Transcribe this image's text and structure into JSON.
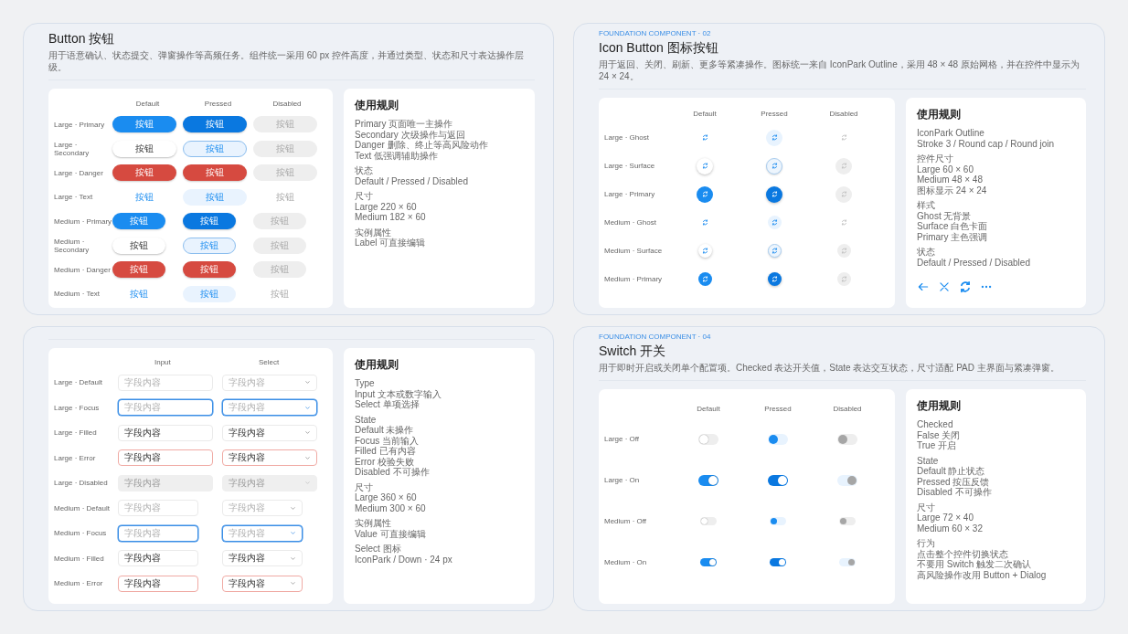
{
  "panels": [
    {
      "kind": "buttons",
      "title": "Button 按钮",
      "description": "用于语意确认、状态提交、弹窗操作等高频任务。组件统一采用 60 px 控件高度，并通过类型、状态和尺寸表达操作层级。",
      "columns": [
        {
          "label": "Default",
          "kind": "default"
        },
        {
          "label": "Pressed",
          "kind": "pressed"
        },
        {
          "label": "Disabled",
          "kind": "disabled"
        }
      ],
      "rows": [
        {
          "label": "Large · Primary",
          "large": true,
          "kind": "primary",
          "cells": [
            "按钮",
            "按钮",
            "按钮"
          ]
        },
        {
          "label": "Large · Secondary",
          "large": true,
          "kind": "secondary",
          "cells": [
            "按钮",
            "按钮",
            "按钮"
          ]
        },
        {
          "label": "Large · Danger",
          "large": true,
          "kind": "danger",
          "cells": [
            "按钮",
            "按钮",
            "按钮"
          ]
        },
        {
          "label": "Large · Text",
          "large": true,
          "kind": "text",
          "cells": [
            "按钮",
            "按钮",
            "按钮"
          ]
        },
        {
          "label": "Medium · Primary",
          "large": false,
          "kind": "primary",
          "cells": [
            "按钮",
            "按钮",
            "按钮"
          ]
        },
        {
          "label": "Medium · Secondary",
          "large": false,
          "kind": "secondary",
          "cells": [
            "按钮",
            "按钮",
            "按钮"
          ]
        },
        {
          "label": "Medium · Danger",
          "large": false,
          "kind": "danger",
          "cells": [
            "按钮",
            "按钮",
            "按钮"
          ]
        },
        {
          "label": "Medium · Text",
          "large": false,
          "kind": "text",
          "cells": [
            "按钮",
            "按钮",
            "按钮"
          ]
        }
      ],
      "rules": {
        "title": "使用规则",
        "groups": [
          [
            "Primary 页面唯一主操作",
            "Secondary 次级操作与返回",
            "Danger 删除、终止等高风险动作",
            "Text 低强调辅助操作"
          ],
          [
            "状态",
            "Default / Pressed / Disabled"
          ],
          [
            "尺寸",
            "Large 220 × 60",
            "Medium 182 × 60"
          ],
          [
            "实例属性",
            "Label 可直接编辑"
          ]
        ]
      }
    },
    {
      "kind": "icon_buttons",
      "eyebrow": "FOUNDATION COMPONENT · 02",
      "title": "Icon Button 图标按钮",
      "description": "用于返回、关闭、刷新、更多等紧凑操作。图标统一来自 IconPark Outline，采用 48 × 48 原始网格，并在控件中显示为 24 × 24。",
      "columns": [
        {
          "label": "Default",
          "kind": "default"
        },
        {
          "label": "Pressed",
          "kind": "pressed"
        },
        {
          "label": "Disabled",
          "kind": "disabled"
        }
      ],
      "rows": [
        {
          "label": "Large · Ghost",
          "large": true,
          "kind": "ghost"
        },
        {
          "label": "Large · Surface",
          "large": true,
          "kind": "surface"
        },
        {
          "label": "Large · Primary",
          "large": true,
          "kind": "primary"
        },
        {
          "label": "Medium · Ghost",
          "large": false,
          "kind": "ghost"
        },
        {
          "label": "Medium · Surface",
          "large": false,
          "kind": "surface"
        },
        {
          "label": "Medium · Primary",
          "large": false,
          "kind": "primary"
        }
      ],
      "rules": {
        "title": "使用规则",
        "groups": [
          [
            "IconPark Outline",
            "Stroke 3 / Round cap / Round join"
          ],
          [
            "控件尺寸",
            "Large 60 × 60",
            "Medium 48 × 48",
            "图标显示 24 × 24"
          ],
          [
            "样式",
            "Ghost 无背景",
            "Surface 白色卡面",
            "Primary 主色强调"
          ],
          [
            "状态",
            "Default / Pressed / Disabled"
          ]
        ]
      }
    },
    {
      "kind": "fields",
      "columns": [
        {
          "label": "Input",
          "kind": "input"
        },
        {
          "label": "Select",
          "kind": "select"
        }
      ],
      "rows": [
        {
          "label": "Large · Default",
          "large": true,
          "kind": "default",
          "cells": [
            {
              "placeholder": "字段内容"
            },
            {
              "placeholder": "字段内容"
            }
          ]
        },
        {
          "label": "Large · Focus",
          "large": true,
          "kind": "focus",
          "cells": [
            {
              "placeholder": "字段内容"
            },
            {
              "placeholder": "字段内容"
            }
          ]
        },
        {
          "label": "Large · Filled",
          "large": true,
          "kind": "filled",
          "cells": [
            {
              "value": "字段内容"
            },
            {
              "value": "字段内容"
            }
          ]
        },
        {
          "label": "Large · Error",
          "large": true,
          "kind": "error",
          "cells": [
            {
              "value": "字段内容"
            },
            {
              "value": "字段内容"
            }
          ]
        },
        {
          "label": "Large · Disabled",
          "large": true,
          "kind": "disabled",
          "cells": [
            {
              "placeholder": "字段内容"
            },
            {
              "placeholder": "字段内容"
            }
          ]
        },
        {
          "label": "Medium · Default",
          "large": false,
          "kind": "default",
          "cells": [
            {
              "placeholder": "字段内容"
            },
            {
              "placeholder": "字段内容"
            }
          ]
        },
        {
          "label": "Medium · Focus",
          "large": false,
          "kind": "focus",
          "cells": [
            {
              "placeholder": "字段内容"
            },
            {
              "placeholder": "字段内容"
            }
          ]
        },
        {
          "label": "Medium · Filled",
          "large": false,
          "kind": "filled",
          "cells": [
            {
              "value": "字段内容"
            },
            {
              "value": "字段内容"
            }
          ]
        },
        {
          "label": "Medium · Error",
          "large": false,
          "kind": "error",
          "cells": [
            {
              "value": "字段内容"
            },
            {
              "value": "字段内容"
            }
          ]
        }
      ],
      "rules": {
        "title": "使用规则",
        "groups": [
          [
            "Type",
            "Input 文本或数字输入",
            "Select 单项选择"
          ],
          [
            "State",
            "Default 未操作",
            "Focus 当前输入",
            "Filled 已有内容",
            "Error 校验失败",
            "Disabled 不可操作"
          ],
          [
            "尺寸",
            "Large 360 × 60",
            "Medium 300 × 60"
          ],
          [
            "实例属性",
            "Value 可直接编辑"
          ],
          [
            "Select 图标",
            "IconPark / Down · 24 px"
          ]
        ]
      }
    },
    {
      "kind": "switches",
      "eyebrow": "FOUNDATION COMPONENT · 04",
      "title": "Switch 开关",
      "description": "用于即时开启或关闭单个配置项。Checked 表达开关值，State 表达交互状态，尺寸适配 PAD 主界面与紧凑弹窗。",
      "columns": [
        {
          "label": "Default",
          "kind": "default"
        },
        {
          "label": "Pressed",
          "kind": "pressed"
        },
        {
          "label": "Disabled",
          "kind": "disabled"
        }
      ],
      "rows": [
        {
          "label": "Large · Off",
          "large": true,
          "on": false
        },
        {
          "label": "Large · On",
          "large": true,
          "on": true
        },
        {
          "label": "Medium · Off",
          "large": false,
          "on": false
        },
        {
          "label": "Medium · On",
          "large": false,
          "on": true
        }
      ],
      "rules": {
        "title": "使用规则",
        "groups": [
          [
            "Checked",
            "False 关闭",
            "True 开启"
          ],
          [
            "State",
            "Default 静止状态",
            "Pressed 按压反馈",
            "Disabled 不可操作"
          ],
          [
            "尺寸",
            "Large 72 × 40",
            "Medium 60 × 32"
          ],
          [
            "行为",
            "点击整个控件切换状态",
            "不要用 Switch 触发二次确认",
            "高风险操作改用 Button + Dialog"
          ]
        ]
      }
    }
  ]
}
